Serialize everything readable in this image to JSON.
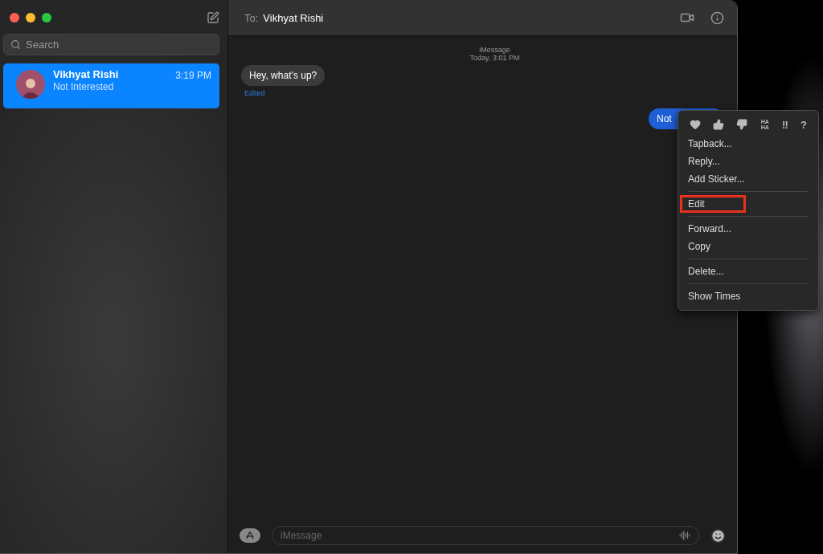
{
  "sidebar": {
    "search": {
      "placeholder": "Search"
    },
    "conversations": [
      {
        "name": "Vikhyat Rishi",
        "time": "3:19 PM",
        "preview": "Not Interested",
        "selected": true
      }
    ]
  },
  "chat": {
    "to_label": "To:",
    "recipient": "Vikhyat Rishi",
    "service": "iMessage",
    "timestamp": "Today, 3:01 PM",
    "messages": [
      {
        "text": "Hey, what’s up?",
        "outgoing": false,
        "note": "Edited"
      },
      {
        "text": "Not",
        "outgoing": true
      }
    ],
    "composer": {
      "placeholder": "iMessage"
    }
  },
  "context_menu": {
    "tapbacks": [
      {
        "kind": "heart"
      },
      {
        "kind": "thumbs-up"
      },
      {
        "kind": "thumbs-down"
      },
      {
        "kind": "text",
        "label": "HA HA"
      },
      {
        "kind": "text",
        "label": "‼"
      },
      {
        "kind": "text",
        "label": "?"
      }
    ],
    "groups": [
      [
        {
          "label": "Tapback...",
          "highlighted": false
        },
        {
          "label": "Reply...",
          "highlighted": false
        },
        {
          "label": "Add Sticker...",
          "highlighted": false
        }
      ],
      [
        {
          "label": "Edit",
          "highlighted": true
        }
      ],
      [
        {
          "label": "Forward...",
          "highlighted": false
        },
        {
          "label": "Copy",
          "highlighted": false
        }
      ],
      [
        {
          "label": "Delete...",
          "highlighted": false
        }
      ],
      [
        {
          "label": "Show Times",
          "highlighted": false
        }
      ]
    ]
  }
}
